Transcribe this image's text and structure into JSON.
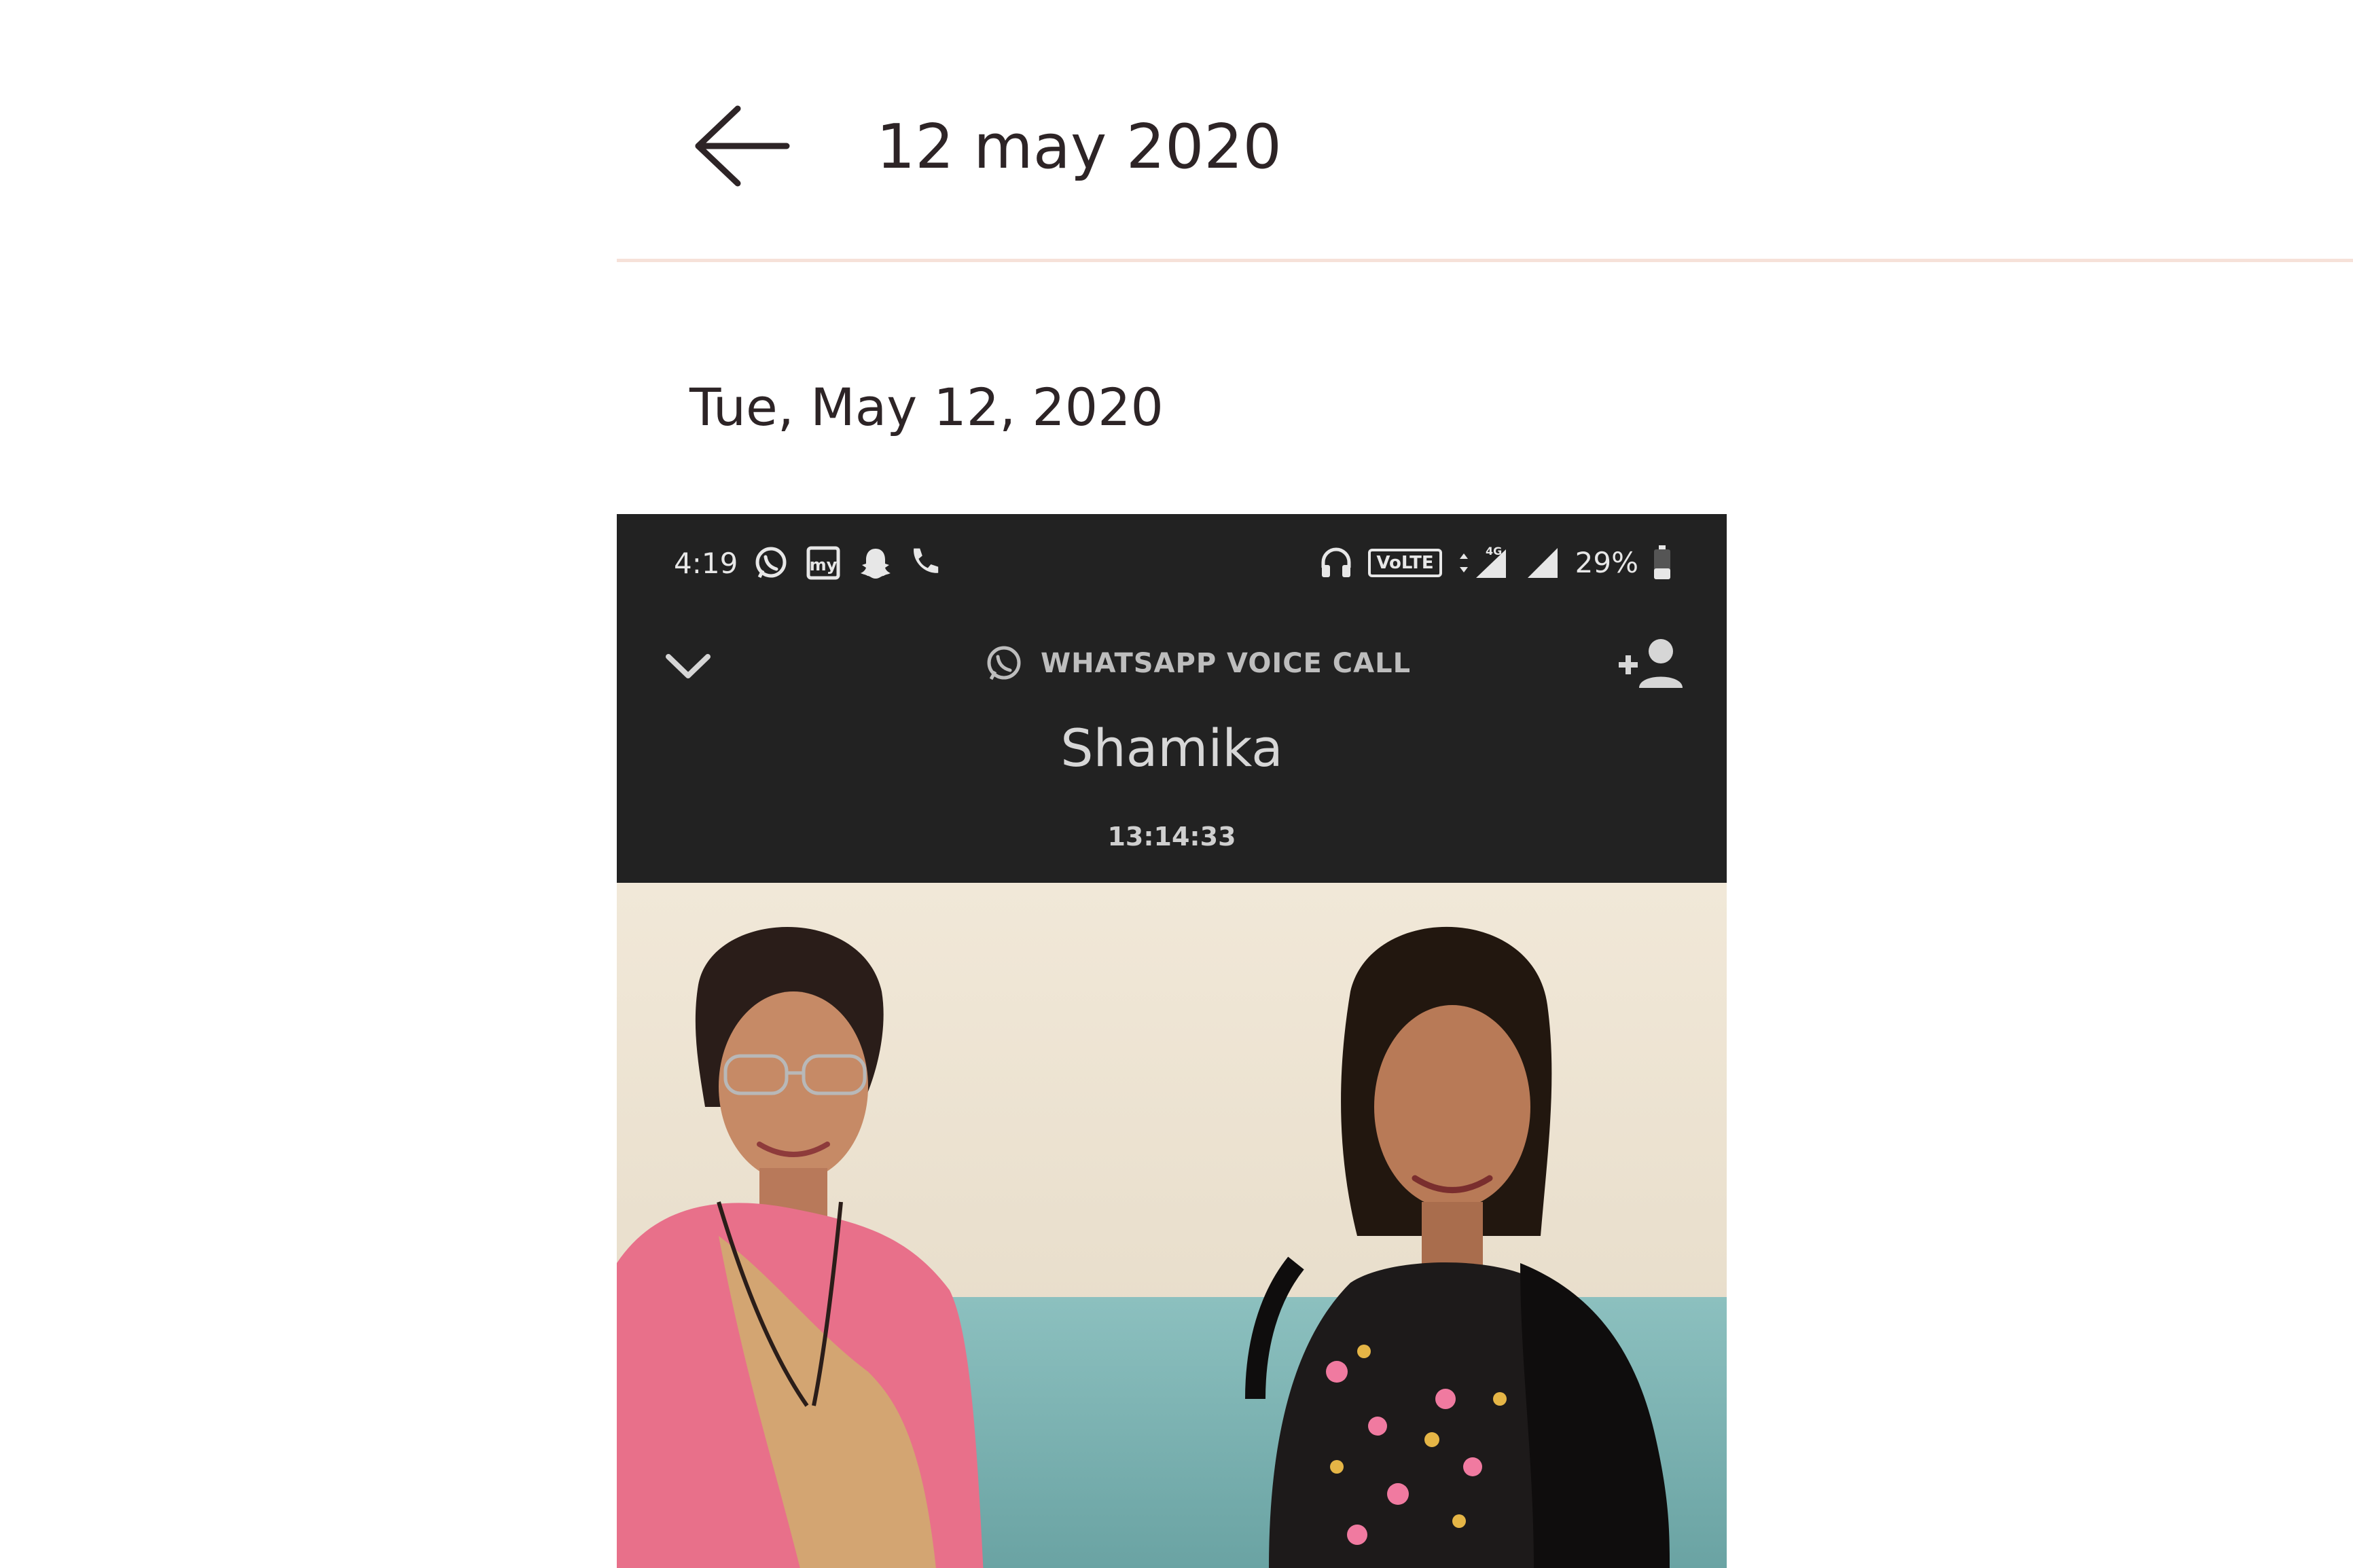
{
  "header": {
    "title": "12 may 2020",
    "back_icon": "arrow-left-icon"
  },
  "entry": {
    "date": "Tue, May 12, 2020"
  },
  "screenshot": {
    "status_bar": {
      "time": "4:19",
      "left_icons": [
        "whatsapp-icon",
        "app-my-icon",
        "snapchat-icon",
        "phone-icon"
      ],
      "right_icons": [
        "headphones-icon",
        "volte-badge",
        "signal-4g-icon",
        "signal-icon",
        "battery-icon"
      ],
      "volte": "VoLTE",
      "battery": "29%"
    },
    "call": {
      "type_label": "WHATSAPP VOICE CALL",
      "contact_name": "Shamika",
      "duration": "13:14:33"
    },
    "photo": {
      "subject": "photo-two-women-icon"
    }
  },
  "colors": {
    "text": "#2d2426",
    "divider": "#f6e1d9",
    "call_bg": "#222222",
    "photo_wall": "#ede3d3",
    "sofa": "#7fb4b4",
    "saree_pink": "#e8708a",
    "saree_gold": "#cfae6d"
  }
}
